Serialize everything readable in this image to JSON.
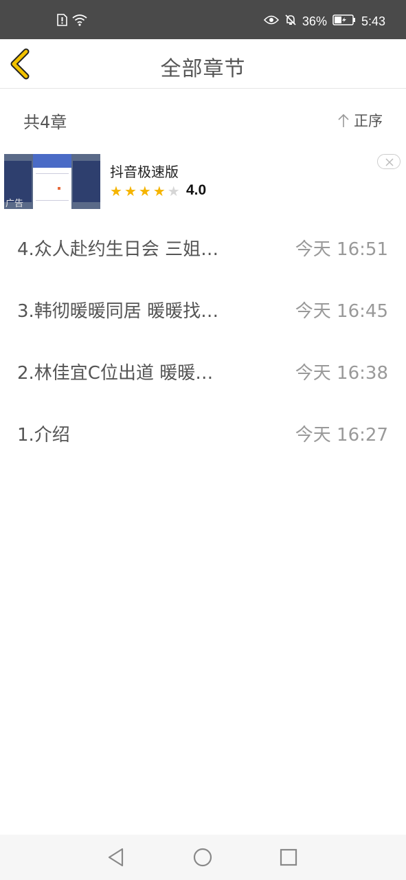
{
  "status_bar": {
    "battery_percent": "36%",
    "time": "5:43",
    "icons": [
      "sim-alert-icon",
      "wifi-icon",
      "eye-comfort-icon",
      "notification-off-icon",
      "battery-icon"
    ]
  },
  "header": {
    "title": "全部章节",
    "back_icon": "chevron-left-icon",
    "accent_color": "#f2c200"
  },
  "summary": {
    "count": "共4章",
    "sort_label": "正序",
    "sort_icon": "arrow-up-icon"
  },
  "ad": {
    "label": "广告",
    "app_name": "抖音极速版",
    "rating": "4.0",
    "stars_filled": 4,
    "stars_total": 5,
    "close_icon": "close-icon"
  },
  "chapters": [
    {
      "title": "4.众人赴约生日会 三姐…",
      "time": "今天 16:51"
    },
    {
      "title": "3.韩彻暖暖同居  暖暖找…",
      "time": "今天 16:45"
    },
    {
      "title": "2.林佳宜C位出道  暖暖…",
      "time": "今天 16:38"
    },
    {
      "title": "1.介绍",
      "time": "今天 16:27"
    }
  ],
  "nav": {
    "back_icon": "triangle-back-icon",
    "home_icon": "circle-home-icon",
    "recents_icon": "square-recents-icon"
  }
}
